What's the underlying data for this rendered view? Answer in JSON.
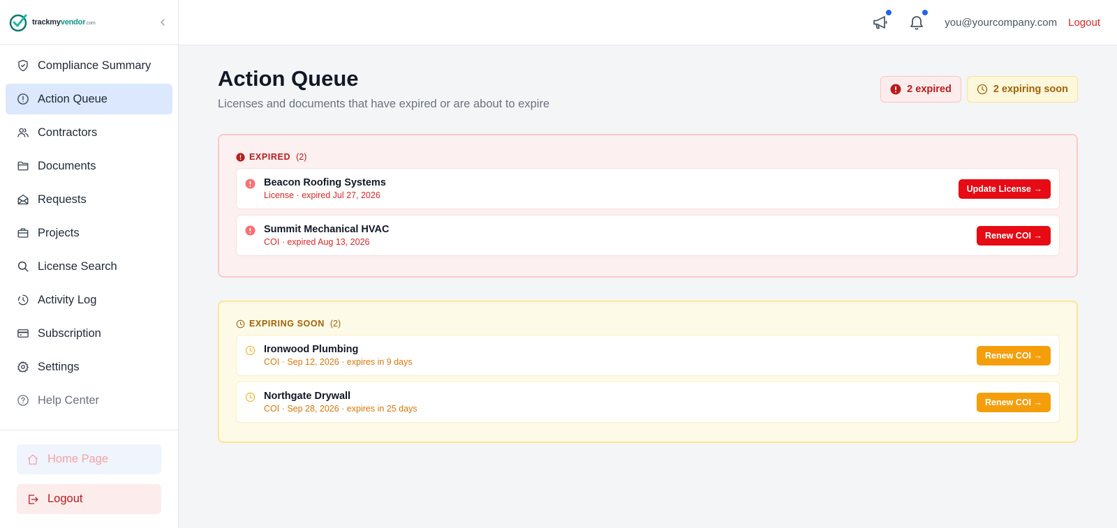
{
  "brand": {
    "logo_main": "trackmy",
    "logo_accent": "vendor",
    "logo_domain": ".com"
  },
  "sidebar": {
    "items": [
      {
        "label": "Compliance Summary",
        "icon": "shield-check-icon"
      },
      {
        "label": "Action Queue",
        "icon": "alert-circle-icon",
        "active": true
      },
      {
        "label": "Contractors",
        "icon": "users-icon"
      },
      {
        "label": "Documents",
        "icon": "folder-icon"
      },
      {
        "label": "Requests",
        "icon": "mail-open-icon"
      },
      {
        "label": "Projects",
        "icon": "briefcase-icon"
      },
      {
        "label": "License Search",
        "icon": "search-icon"
      },
      {
        "label": "Activity Log",
        "icon": "history-clock-icon"
      },
      {
        "label": "Subscription",
        "icon": "credit-card-icon"
      },
      {
        "label": "Settings",
        "icon": "gear-icon"
      },
      {
        "label": "Help Center",
        "icon": "help-circle-icon"
      }
    ],
    "home_label": "Home Page",
    "logout_label": "Logout"
  },
  "topbar": {
    "email": "you@yourcompany.com",
    "logout": "Logout"
  },
  "page": {
    "title": "Action Queue",
    "subtitle": "Licenses and documents that have expired or are about to expire",
    "pill_expired": "2 expired",
    "pill_soon": "2 expiring soon"
  },
  "expired": {
    "heading": "EXPIRED",
    "count": "(2)",
    "rows": [
      {
        "name": "Beacon Roofing Systems",
        "meta": "License · expired Jul 27, 2026",
        "action": "Update License →"
      },
      {
        "name": "Summit Mechanical HVAC",
        "meta": "COI · expired Aug 13, 2026",
        "action": "Renew COI →"
      }
    ]
  },
  "soon": {
    "heading": "EXPIRING SOON",
    "count": "(2)",
    "rows": [
      {
        "name": "Ironwood Plumbing",
        "meta": "COI · Sep 12, 2026 · expires in 9 days",
        "action": "Renew COI →"
      },
      {
        "name": "Northgate Drywall",
        "meta": "COI · Sep 28, 2026 · expires in 25 days",
        "action": "Renew COI →"
      }
    ]
  },
  "colors": {
    "accent": "#2563eb",
    "active_nav_bg": "#dbe8fd",
    "expired": "#e60b14",
    "expiring": "#f59e0b"
  }
}
